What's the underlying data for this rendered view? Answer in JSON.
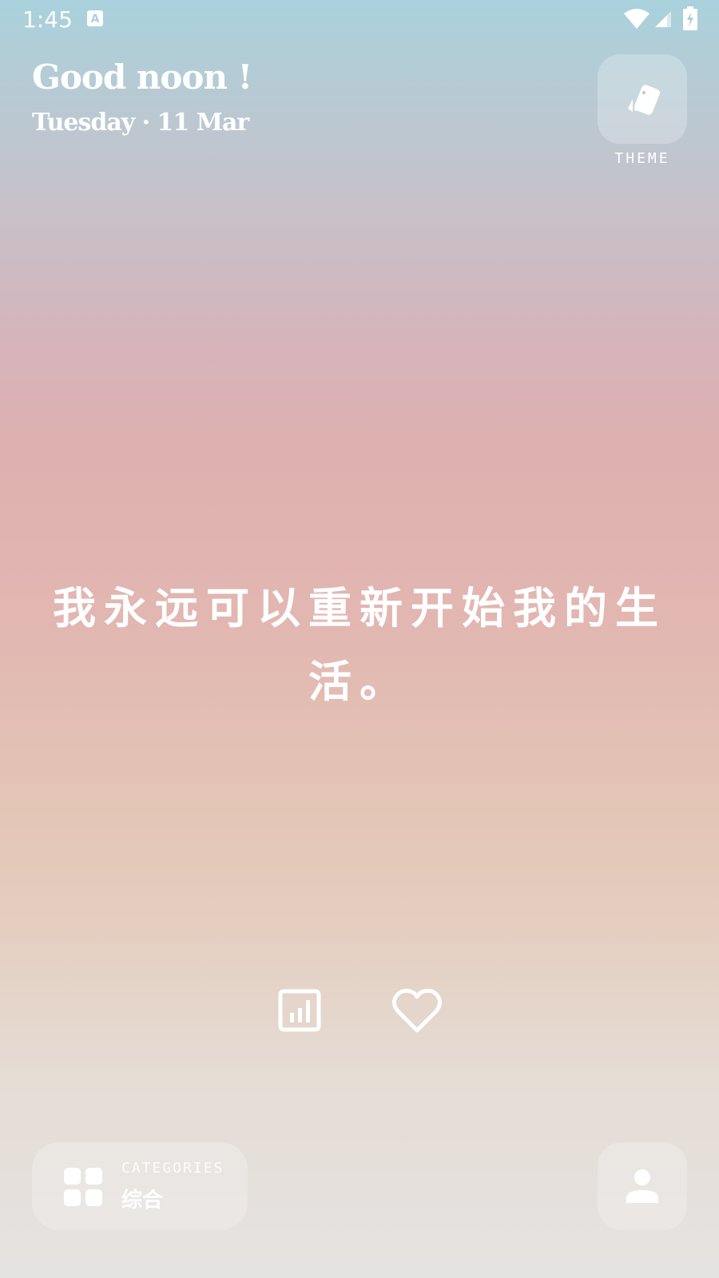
{
  "status_bar": {
    "time": "1:45",
    "icons": [
      "keyboard-a-icon",
      "wifi-icon",
      "signal-icon",
      "battery-charging-icon"
    ]
  },
  "header": {
    "greeting": "Good noon !",
    "date": "Tuesday · 11 Mar"
  },
  "theme": {
    "label": "THEME",
    "icon": "cards-icon"
  },
  "quote": {
    "text": "我永远可以重新开始我的生活。"
  },
  "actions": {
    "stats_icon": "stats-icon",
    "favorite_icon": "heart-icon"
  },
  "categories": {
    "label": "CATEGORIES",
    "value": "综合",
    "icon": "grid-icon"
  },
  "profile": {
    "icon": "person-icon"
  },
  "colors": {
    "gradient_top": "#a9d2dc",
    "gradient_mid": "#deb0b0",
    "gradient_bottom": "#e5e3e2",
    "foreground": "#ffffff"
  }
}
